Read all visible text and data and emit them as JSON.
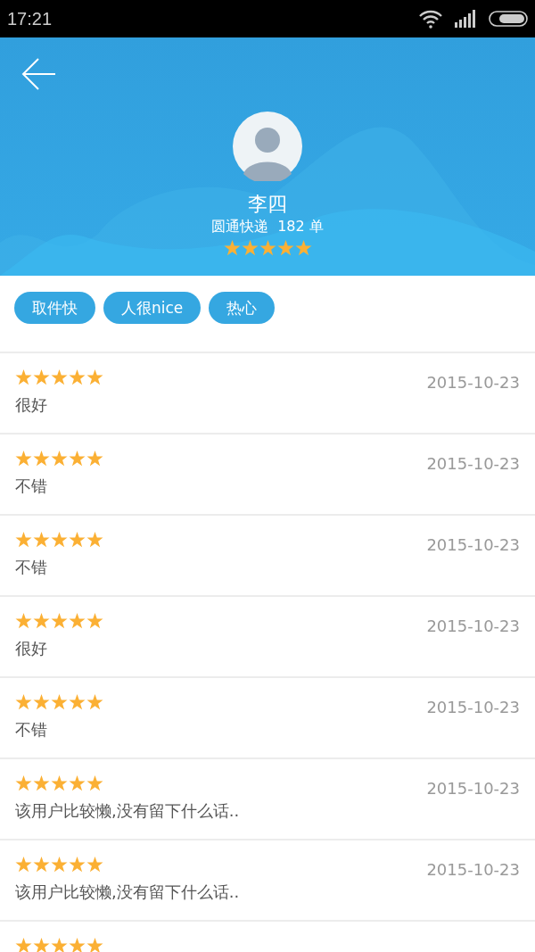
{
  "status_bar": {
    "time": "17:21"
  },
  "courier": {
    "name": "李四",
    "company": "圆通快递",
    "orders": "182 单",
    "stars": 5
  },
  "tags": [
    {
      "label": "取件快"
    },
    {
      "label": "人很nice"
    },
    {
      "label": "热心"
    }
  ],
  "reviews": [
    {
      "stars": 5,
      "date": "2015-10-23",
      "comment": "很好"
    },
    {
      "stars": 5,
      "date": "2015-10-23",
      "comment": "不错"
    },
    {
      "stars": 5,
      "date": "2015-10-23",
      "comment": "不错"
    },
    {
      "stars": 5,
      "date": "2015-10-23",
      "comment": "很好"
    },
    {
      "stars": 5,
      "date": "2015-10-23",
      "comment": "不错"
    },
    {
      "stars": 5,
      "date": "2015-10-23",
      "comment": "该用户比较懒,没有留下什么话.."
    },
    {
      "stars": 5,
      "date": "2015-10-23",
      "comment": "该用户比较懒,没有留下什么话.."
    },
    {
      "stars": 5
    }
  ]
}
